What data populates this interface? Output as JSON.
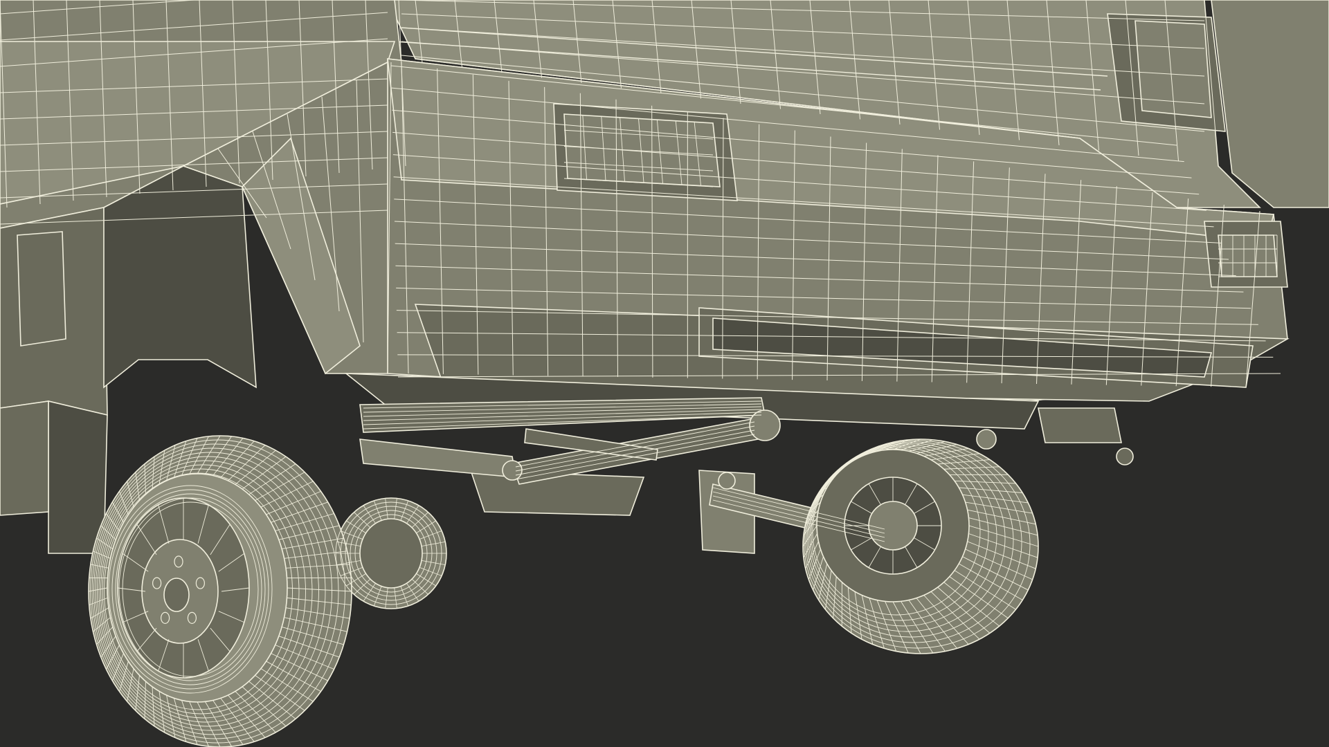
{
  "scene": {
    "subject": "rear-underside-of-vehicle-wireframe-render",
    "background_color": "#2b2b29",
    "body_fill": "#80806f",
    "body_fill_light": "#8e8e7c",
    "body_fill_dark": "#6a6a5b",
    "shadow_fill": "#4d4d43",
    "wire_color": "#f0eedc",
    "wire_color_dim": "#d9d7c2"
  }
}
